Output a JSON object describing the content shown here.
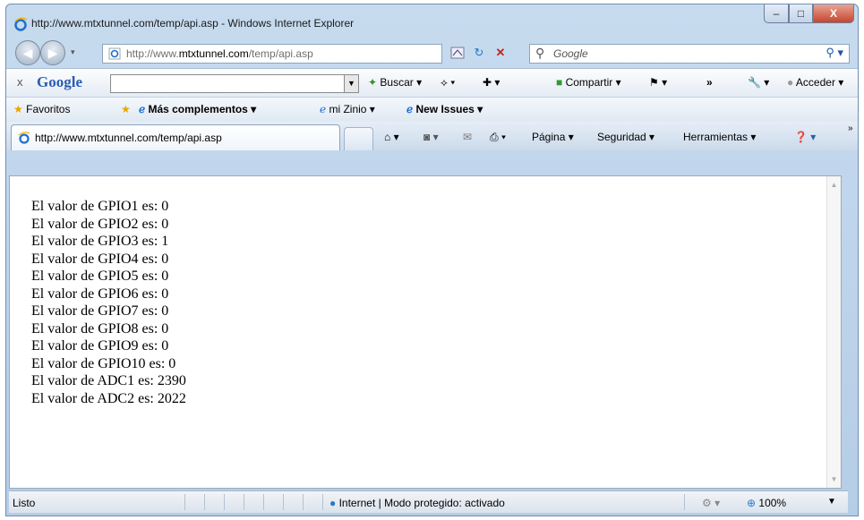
{
  "window": {
    "title": "http://www.mtxtunnel.com/temp/api.asp - Windows Internet Explorer",
    "controls": {
      "minimize": "–",
      "maximize": "□",
      "close": "X"
    }
  },
  "address": {
    "url_prefix": "http://www.",
    "url_domain": "mtxtunnel.com",
    "url_path": "/temp/api.asp",
    "search_placeholder": "Google"
  },
  "google_bar": {
    "close": "x",
    "logo": "Google",
    "search_button": "Buscar",
    "share_button": "Compartir",
    "more": "»",
    "signin": "Acceder"
  },
  "favorites": {
    "label": "Favoritos",
    "items": [
      "Más complementos ▾",
      "mi Zinio ▾",
      "New Issues ▾"
    ]
  },
  "tabs": {
    "active_title": "http://www.mtxtunnel.com/temp/api.asp",
    "commands": {
      "page": "Página ▾",
      "security": "Seguridad ▾",
      "tools": "Herramientas ▾"
    }
  },
  "content": {
    "lines": [
      "El valor de GPIO1 es: 0",
      "El valor de GPIO2 es: 0",
      "El valor de GPIO3 es: 1",
      "El valor de GPIO4 es: 0",
      "El valor de GPIO5 es: 0",
      "El valor de GPIO6 es: 0",
      "El valor de GPIO7 es: 0",
      "El valor de GPIO8 es: 0",
      "El valor de GPIO9 es: 0",
      "El valor de GPIO10 es: 0",
      "El valor de ADC1 es: 2390",
      "El valor de ADC2 es: 2022"
    ]
  },
  "status": {
    "text": "Listo",
    "zone": "Internet | Modo protegido: activado",
    "zoom": "100%"
  },
  "colors": {
    "frame": "#b5cde6",
    "ie_blue": "#1e6fd0"
  }
}
